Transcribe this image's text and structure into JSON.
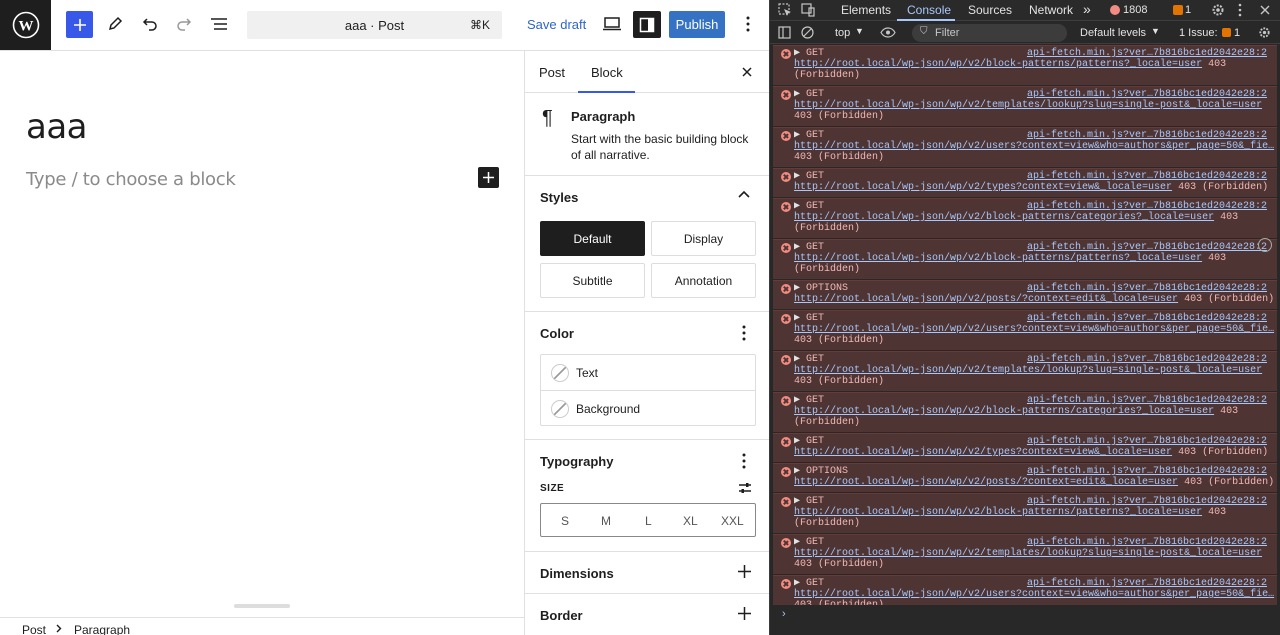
{
  "editor": {
    "doc_title": "aaa · Post",
    "shortcut": "⌘K",
    "save_draft": "Save draft",
    "publish": "Publish",
    "post_title": "aaa",
    "block_placeholder": "Type / to choose a block"
  },
  "sidebar": {
    "tabs": [
      "Post",
      "Block"
    ],
    "active_tab": "Block",
    "block_name": "Paragraph",
    "block_desc": "Start with the basic building block of all narrative.",
    "styles_title": "Styles",
    "styles": [
      "Default",
      "Display",
      "Subtitle",
      "Annotation"
    ],
    "selected_style": "Default",
    "color_title": "Color",
    "color_items": [
      "Text",
      "Background"
    ],
    "typography_title": "Typography",
    "size_label": "SIZE",
    "sizes": [
      "S",
      "M",
      "L",
      "XL",
      "XXL"
    ],
    "dimensions_title": "Dimensions",
    "border_title": "Border"
  },
  "breadcrumb": [
    "Post",
    "Paragraph"
  ],
  "devtools": {
    "tabs": [
      "Elements",
      "Console",
      "Sources",
      "Network"
    ],
    "active_tab": "Console",
    "error_count": "1808",
    "warning_count": "1",
    "context": "top",
    "filter_placeholder": "Filter",
    "levels": "Default levels",
    "issues_label": "1 Issue:",
    "issues_count": "1",
    "source": "api-fetch.min.js?ver…7b816bc1ed2042e28:2",
    "entries": [
      {
        "method": "GET",
        "lines": [
          "http://root.local/wp-json/wp/v2/block-patterns/patterns?_locale=user 403",
          "(Forbidden)"
        ]
      },
      {
        "method": "GET",
        "lines": [
          "http://root.local/wp-json/wp/v2/templates/lookup?slug=single-post&_locale=user",
          "403 (Forbidden)"
        ]
      },
      {
        "method": "GET",
        "lines": [
          "http://root.local/wp-json/wp/v2/users?context=view&who=authors&per_page=50&_fie…",
          "403 (Forbidden)"
        ]
      },
      {
        "method": "GET",
        "lines": [
          "http://root.local/wp-json/wp/v2/types?context=view&_locale=user 403 (Forbidden)"
        ]
      },
      {
        "method": "GET",
        "lines": [
          "http://root.local/wp-json/wp/v2/block-patterns/categories?_locale=user 403",
          "(Forbidden)"
        ]
      },
      {
        "method": "GET",
        "lines": [
          "http://root.local/wp-json/wp/v2/block-patterns/patterns?_locale=user 403",
          "(Forbidden)"
        ]
      },
      {
        "method": "OPTIONS",
        "lines": [
          "http://root.local/wp-json/wp/v2/posts/?context=edit&_locale=user 403 (Forbidden)"
        ]
      },
      {
        "method": "GET",
        "lines": [
          "http://root.local/wp-json/wp/v2/users?context=view&who=authors&per_page=50&_fie…",
          "403 (Forbidden)"
        ]
      },
      {
        "method": "GET",
        "lines": [
          "http://root.local/wp-json/wp/v2/templates/lookup?slug=single-post&_locale=user",
          "403 (Forbidden)"
        ]
      },
      {
        "method": "GET",
        "lines": [
          "http://root.local/wp-json/wp/v2/block-patterns/categories?_locale=user 403",
          "(Forbidden)"
        ]
      },
      {
        "method": "GET",
        "lines": [
          "http://root.local/wp-json/wp/v2/types?context=view&_locale=user 403 (Forbidden)"
        ]
      },
      {
        "method": "OPTIONS",
        "lines": [
          "http://root.local/wp-json/wp/v2/posts/?context=edit&_locale=user 403 (Forbidden)"
        ]
      },
      {
        "method": "GET",
        "lines": [
          "http://root.local/wp-json/wp/v2/block-patterns/patterns?_locale=user 403",
          "(Forbidden)"
        ]
      },
      {
        "method": "GET",
        "lines": [
          "http://root.local/wp-json/wp/v2/templates/lookup?slug=single-post&_locale=user",
          "403 (Forbidden)"
        ]
      },
      {
        "method": "GET",
        "lines": [
          "http://root.local/wp-json/wp/v2/users?context=view&who=authors&per_page=50&_fie…",
          "403 (Forbidden)"
        ]
      }
    ],
    "prompt": "›"
  }
}
